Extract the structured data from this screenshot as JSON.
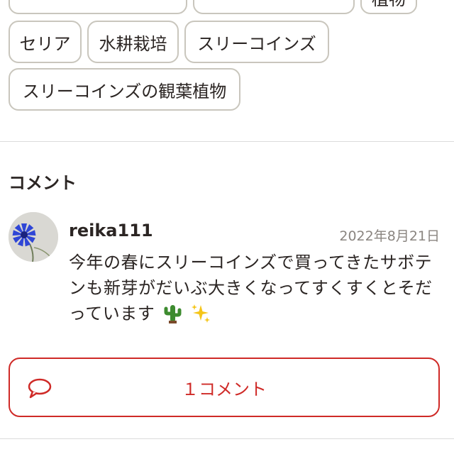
{
  "tags": {
    "row1_partial": [
      "",
      "",
      "植物"
    ],
    "row2": [
      "セリア",
      "水耕栽培",
      "スリーコインズ"
    ],
    "row3": [
      "スリーコインズの観葉植物"
    ]
  },
  "comments": {
    "title": "コメント",
    "item": {
      "username": "reika111",
      "date": "2022年8月21日",
      "text": "今年の春にスリーコインズで買ってきたサボテンも新芽がだいぶ大きくなってすくすくとそだっています",
      "emojis": [
        "cactus-icon",
        "sparkles-icon"
      ]
    },
    "button_label": "１コメント"
  },
  "colors": {
    "accent": "#cf2a27",
    "tag_border": "#c9c6bd",
    "text": "#2b2523",
    "muted": "#8a8580"
  }
}
